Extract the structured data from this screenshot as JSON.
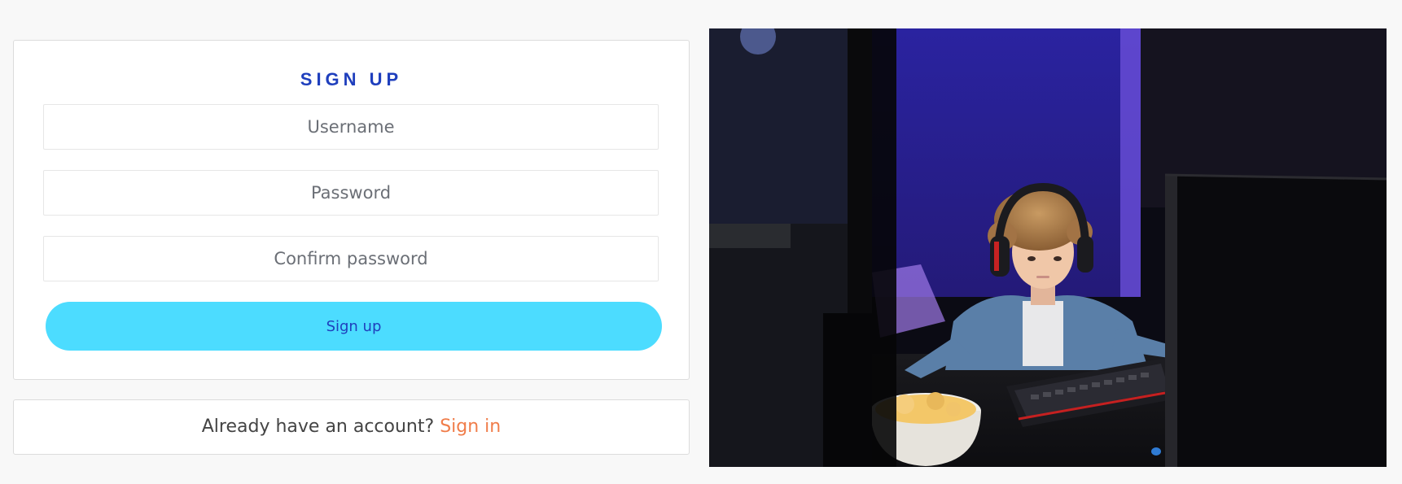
{
  "signup": {
    "title": "SIGN UP",
    "username_placeholder": "Username",
    "password_placeholder": "Password",
    "confirm_placeholder": "Confirm password",
    "button_label": "Sign up"
  },
  "signin": {
    "prompt": "Already have an account?",
    "link_label": "Sign in"
  },
  "colors": {
    "title": "#1f3fbd",
    "button_bg": "#4cdcff",
    "link": "#f07d4a"
  }
}
